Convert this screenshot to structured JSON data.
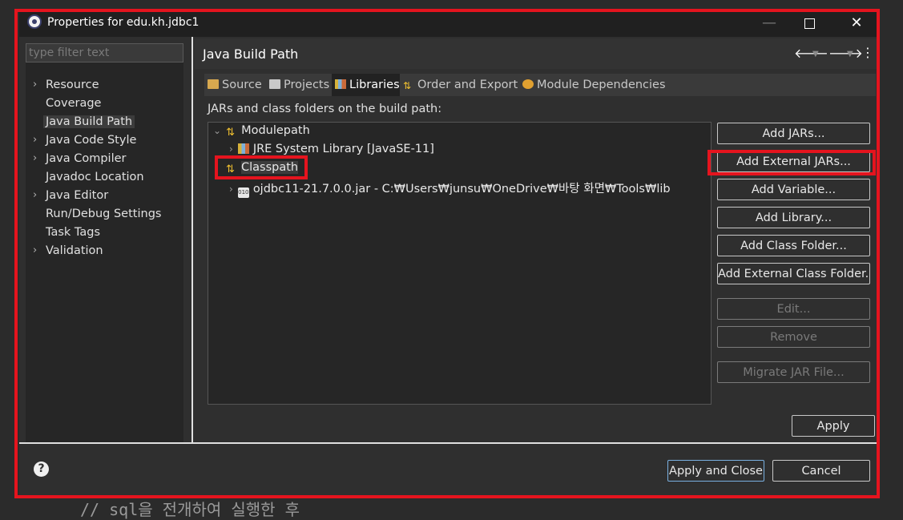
{
  "background_text": "// sql을 전개하여 실행한 후",
  "window": {
    "title": "Properties for edu.kh.jdbc1",
    "minimize": "—",
    "close": "✕"
  },
  "filter": {
    "placeholder": "type filter text"
  },
  "nav": {
    "items": [
      {
        "label": "Resource",
        "expandable": true
      },
      {
        "label": "Coverage",
        "expandable": false
      },
      {
        "label": "Java Build Path",
        "expandable": false,
        "selected": true
      },
      {
        "label": "Java Code Style",
        "expandable": true
      },
      {
        "label": "Java Compiler",
        "expandable": true
      },
      {
        "label": "Javadoc Location",
        "expandable": false
      },
      {
        "label": "Java Editor",
        "expandable": true
      },
      {
        "label": "Run/Debug Settings",
        "expandable": false
      },
      {
        "label": "Task Tags",
        "expandable": false
      },
      {
        "label": "Validation",
        "expandable": true
      }
    ]
  },
  "header": {
    "title": "Java Build Path",
    "back": "🡐",
    "forward": "🡒",
    "dropdown": "▼",
    "menu": "⋮"
  },
  "tabs": [
    {
      "label": "Source",
      "icon": "folder-source-icon"
    },
    {
      "label": "Projects",
      "icon": "projects-icon"
    },
    {
      "label": "Libraries",
      "icon": "libraries-icon",
      "active": true
    },
    {
      "label": "Order and Export",
      "icon": "order-export-icon"
    },
    {
      "label": "Module Dependencies",
      "icon": "module-icon"
    }
  ],
  "description": "JARs and class folders on the build path:",
  "tree": {
    "modulepath": "Modulepath",
    "jre": "JRE System Library [JavaSE-11]",
    "classpath": "Classpath",
    "jar": "ojdbc11-21.7.0.0.jar - C:₩Users₩junsu₩OneDrive₩바탕 화면₩Tools₩lib",
    "jar_icon_text": "010",
    "expanded": "⌄",
    "collapsed": "›"
  },
  "buttons": {
    "add_jars": "Add JARs...",
    "add_external_jars": "Add External JARs...",
    "add_variable": "Add Variable...",
    "add_library": "Add Library...",
    "add_class_folder": "Add Class Folder...",
    "add_external_class_folder": "Add External Class Folder...",
    "edit": "Edit...",
    "remove": "Remove",
    "migrate": "Migrate JAR File...",
    "apply": "Apply",
    "apply_and_close": "Apply and Close",
    "cancel": "Cancel"
  },
  "help": "?",
  "colors": {
    "highlight": "#e5141e",
    "focus": "#7ab0e0"
  }
}
